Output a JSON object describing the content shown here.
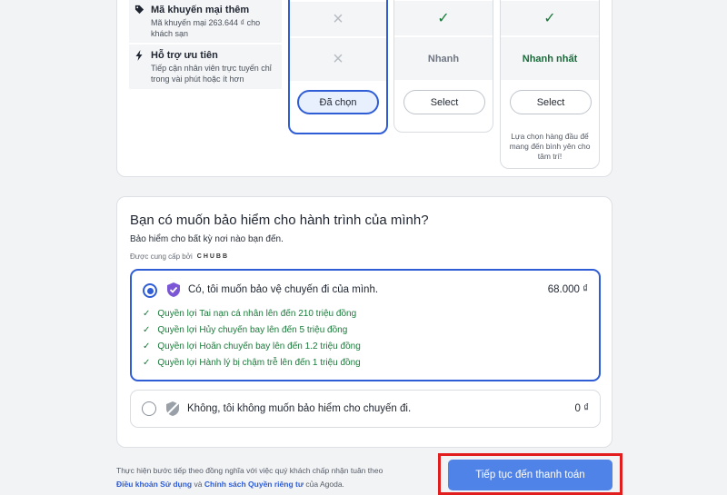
{
  "features": [
    {
      "title": "Mã khuyến mại thêm",
      "desc": "Mã khuyến mại 263.644 ₫ cho khách sạn",
      "icon": "tag-icon"
    },
    {
      "title": "Hỗ trợ ưu tiên",
      "desc": "Tiếp cận nhân viên trực tuyến chỉ trong vài phút hoặc ít hơn",
      "icon": "lightning-icon"
    }
  ],
  "plans": [
    {
      "promo": "×",
      "support": "×",
      "button": "Đã chọn"
    },
    {
      "promo": "✓",
      "support": "Nhanh",
      "button": "Select"
    },
    {
      "promo": "✓",
      "support": "Nhanh nhất",
      "button": "Select",
      "note": "Lựa chọn hàng đầu để mang đến bình yên cho tâm trí!"
    }
  ],
  "insurance": {
    "title": "Bạn có muốn bảo hiểm cho hành trình của mình?",
    "subtitle": "Bảo hiểm cho bất kỳ nơi nào bạn đến.",
    "provided_by": "Được cung cấp bởi",
    "provider": "CHUBB",
    "yes_label": "Có, tôi muốn bảo vệ chuyến đi của mình.",
    "yes_price": "68.000 ₫",
    "benefits": [
      "Quyền lợi Tai nạn cá nhân lên đến 210 triệu đồng",
      "Quyền lợi Hủy chuyến bay lên đến 5 triệu đồng",
      "Quyền lợi Hoãn chuyến bay lên đến 1.2 triệu đồng",
      "Quyền lợi Hành lý bị chậm trễ lên đến 1 triệu đồng"
    ],
    "no_label": "Không, tôi không muốn bảo hiểm cho chuyến đi.",
    "no_price": "0 ₫"
  },
  "footer": {
    "legal_text": "Thực hiện bước tiếp theo đồng nghĩa với việc quý khách chấp nhận tuân theo",
    "terms_link": "Điều khoản Sử dụng",
    "and": "và",
    "privacy_link": "Chính sách Quyền riêng tư",
    "of": "của Agoda.",
    "continue_label": "Tiếp tục đến thanh toán"
  },
  "colors": {
    "accent": "#2f5dd6",
    "button": "#4f83e8",
    "success": "#1a7a3a",
    "highlight": "#e21d1d"
  }
}
